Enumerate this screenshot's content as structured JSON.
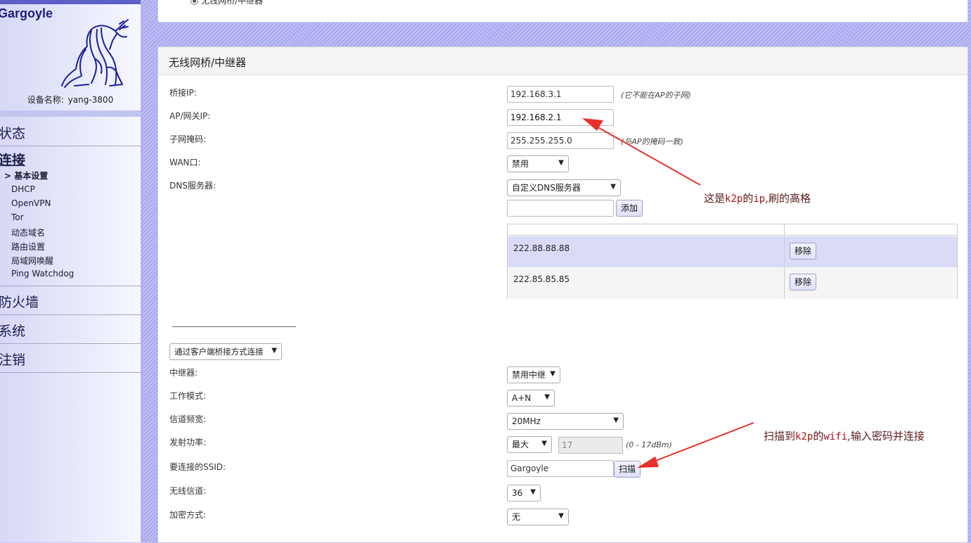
{
  "brand": {
    "title": "Gargoyle",
    "device_label": "设备名称:",
    "device_name": "yang-3800"
  },
  "nav": {
    "status": "状态",
    "connection": "连接",
    "sub": [
      "基本设置",
      "DHCP",
      "OpenVPN",
      "Tor",
      "动态域名",
      "路由设置",
      "局域网唤醒",
      "Ping Watchdog"
    ],
    "active_marker": ">",
    "firewall": "防火墙",
    "system": "系统",
    "logout": "注销"
  },
  "top_panel": {
    "radio_label": "无线网桥/中继器"
  },
  "panel": {
    "title": "无线网桥/中继器",
    "bridge_ip": {
      "label": "桥接IP:",
      "value": "192.168.3.1",
      "hint": "(它不能在AP的子网)"
    },
    "gateway_ip": {
      "label": "AP/网关IP:",
      "value": "192.168.2.1"
    },
    "netmask": {
      "label": "子网掩码:",
      "value": "255.255.255.0",
      "hint": "(与AP的掩码一致)"
    },
    "wan_port": {
      "label": "WAN口:",
      "value": "禁用"
    },
    "dns": {
      "label": "DNS服务器:",
      "mode": "自定义DNS服务器",
      "new_value": "",
      "add_button": "添加",
      "rows": [
        {
          "ip": "222.88.88.88",
          "remove": "移除"
        },
        {
          "ip": "222.85.85.85",
          "remove": "移除"
        }
      ]
    },
    "connect_mode": "通过客户端桥接方式连接",
    "repeater": {
      "label": "中继器:",
      "value": "禁用中继"
    },
    "work_mode": {
      "label": "工作模式:",
      "value": "A+N"
    },
    "bandwidth": {
      "label": "信道频宽:",
      "value": "20MHz"
    },
    "tx_power": {
      "label": "发射功率:",
      "value": "最大",
      "dbm": "17",
      "range": "(0 - 17dBm)"
    },
    "ssid": {
      "label": "要连接的SSID:",
      "value": "Gargoyle",
      "scan_button": "扫描"
    },
    "channel": {
      "label": "无线信道:",
      "value": "36"
    },
    "encryption": {
      "label": "加密方式:",
      "value": "无"
    }
  },
  "annotations": {
    "note1_pre": "这是",
    "note1_code1": "k2p",
    "note1_mid": "的",
    "note1_code2": "ip",
    "note1_post": ",刷的高格",
    "note2_pre": "扫描到",
    "note2_code1": "k2p",
    "note2_mid": "的",
    "note2_code2": "wifi",
    "note2_post": ",输入密码并连接",
    "arrow_color": "#e8312c"
  },
  "colors": {
    "accent": "#5b5fc7",
    "stripe_dark": "#a7a8ee",
    "stripe_light": "#bfc0f3",
    "dns_highlight": "#dadbf7"
  }
}
